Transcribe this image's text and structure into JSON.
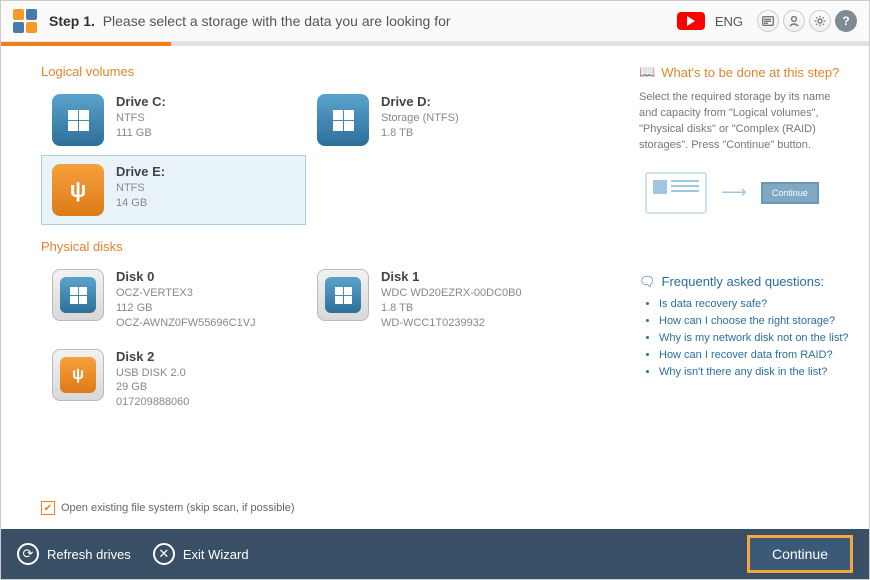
{
  "header": {
    "step_label": "Step 1.",
    "step_text": "Please select a storage with the data you are looking for",
    "lang": "ENG"
  },
  "sections": {
    "logical": "Logical volumes",
    "physical": "Physical disks"
  },
  "logical_volumes": [
    {
      "name": "Drive C:",
      "fs": "NTFS",
      "size": "111 GB",
      "kind": "win",
      "selected": false
    },
    {
      "name": "Drive D:",
      "fs": "Storage (NTFS)",
      "size": "1.8 TB",
      "kind": "win",
      "selected": false
    },
    {
      "name": "Drive E:",
      "fs": "NTFS",
      "size": "14 GB",
      "kind": "usb",
      "selected": true
    }
  ],
  "physical_disks": [
    {
      "name": "Disk 0",
      "l1": "OCZ-VERTEX3",
      "l2": "112 GB",
      "l3": "OCZ-AWNZ0FW55696C1VJ",
      "kind": "win"
    },
    {
      "name": "Disk 1",
      "l1": "WDC WD20EZRX-00DC0B0",
      "l2": "1.8 TB",
      "l3": "WD-WCC1T0239932",
      "kind": "win"
    },
    {
      "name": "Disk 2",
      "l1": "USB DISK 2.0",
      "l2": "29 GB",
      "l3": "017209888060",
      "kind": "usb"
    }
  ],
  "checkbox": {
    "label": "Open existing file system (skip scan, if possible)"
  },
  "help": {
    "heading": "What's to be done at this step?",
    "body": "Select the required storage by its name and capacity from \"Logical volumes\", \"Physical disks\" or \"Complex (RAID) storages\". Press \"Continue\" button.",
    "diagram_btn": "Continue",
    "faq_heading": "Frequently asked questions:",
    "faq": [
      "Is data recovery safe?",
      "How can I choose the right storage?",
      "Why is my network disk not on the list?",
      "How can I recover data from RAID?",
      "Why isn't there any disk in the list?"
    ]
  },
  "footer": {
    "refresh": "Refresh drives",
    "exit": "Exit Wizard",
    "continue": "Continue"
  }
}
